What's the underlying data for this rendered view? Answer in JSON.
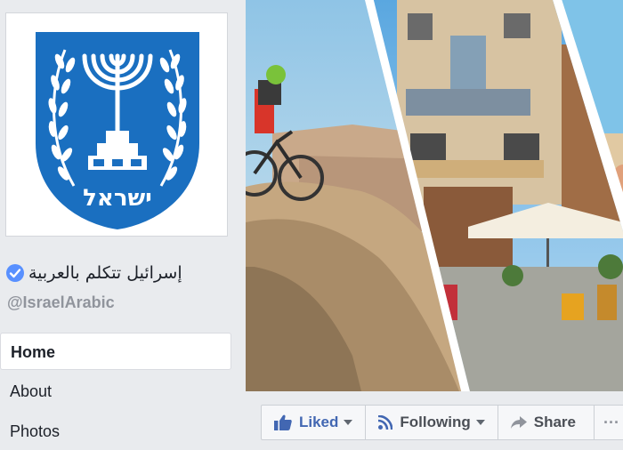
{
  "page": {
    "name": "إسرائيل تتكلم بالعربية",
    "username": "@IsraelArabic",
    "verified": true
  },
  "profile_picture": {
    "icon": "state-of-israel-emblem-icon",
    "emblem_text": "ישראל",
    "colors": {
      "background": "#1a6fc0",
      "symbol": "#ffffff"
    }
  },
  "nav": {
    "items": [
      {
        "label": "Home",
        "active": true
      },
      {
        "label": "About",
        "active": false
      },
      {
        "label": "Photos",
        "active": false
      }
    ]
  },
  "cover": {
    "panels": [
      "mountain-biker-desert-photo",
      "painted-building-cafe-photo",
      "beach-person-photo"
    ]
  },
  "actions": {
    "liked_label": "Liked",
    "following_label": "Following",
    "share_label": "Share",
    "more_label": "···"
  },
  "colors": {
    "accent": "#4267b2",
    "verified": "#5890ff",
    "background": "#e9ebee"
  }
}
